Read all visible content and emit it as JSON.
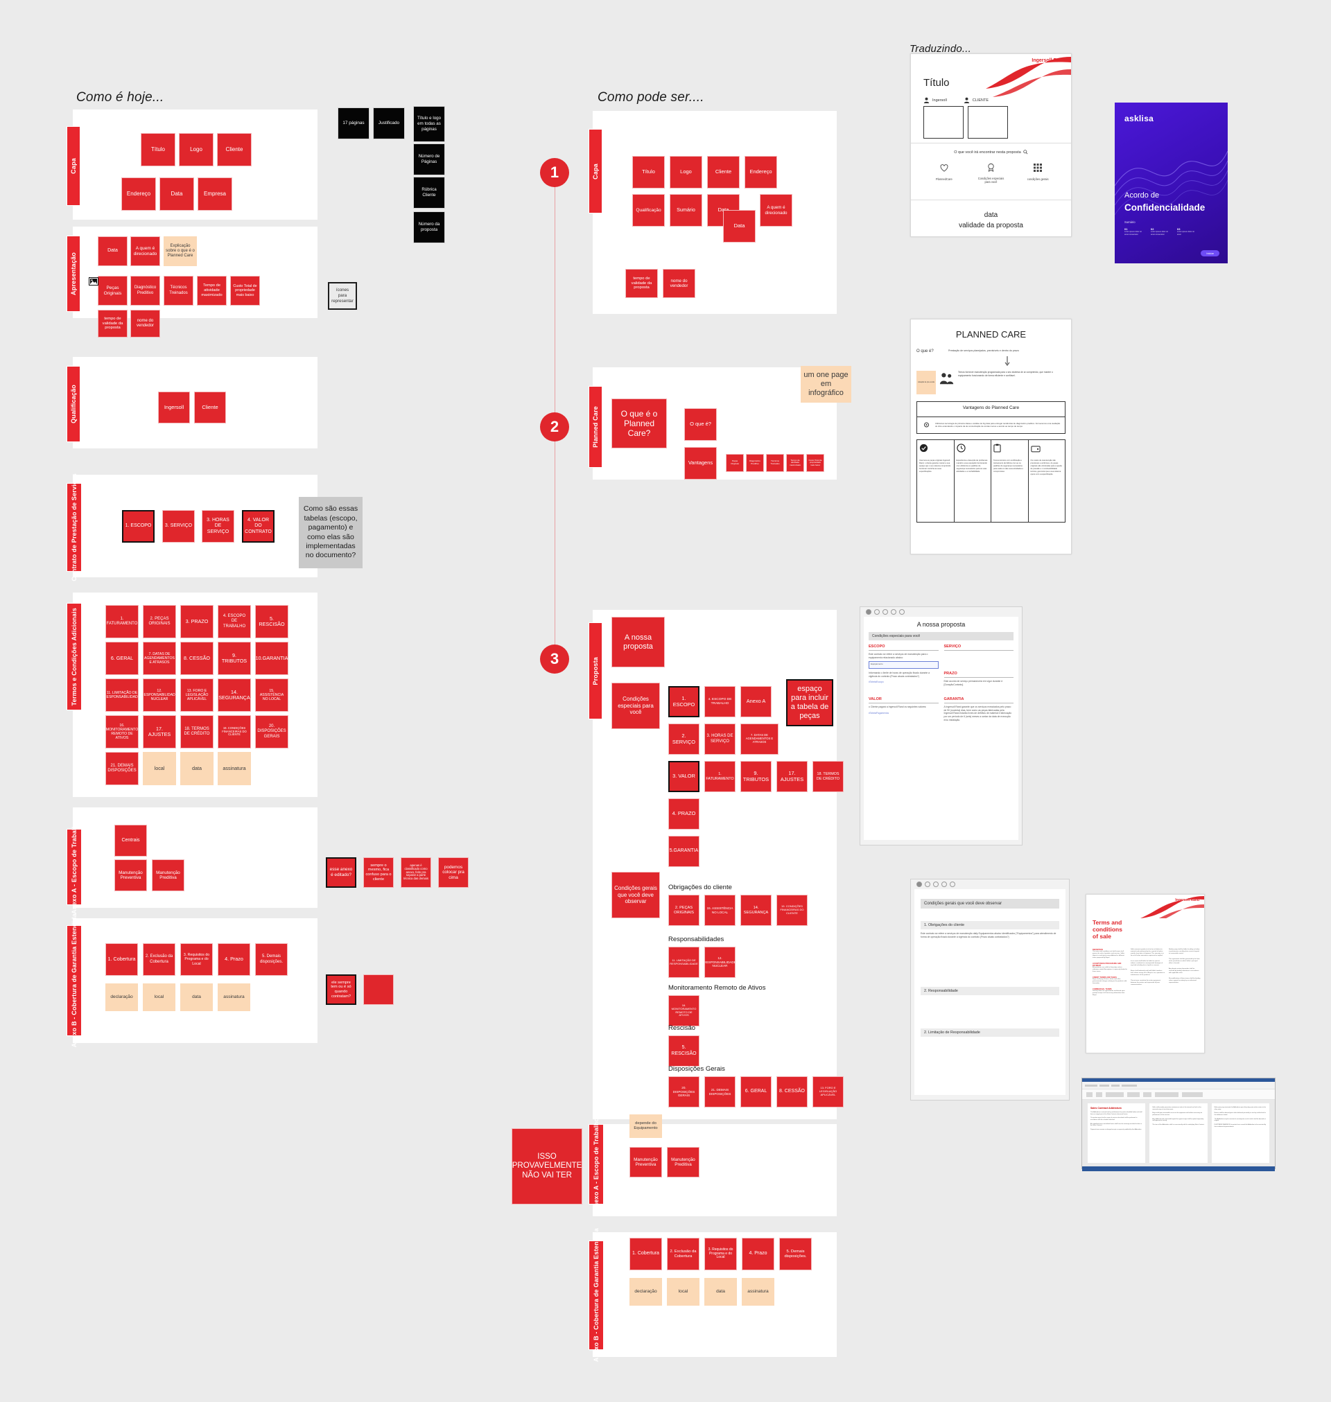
{
  "board": {
    "background": "#ebebeb",
    "accent_red": "#e0262c",
    "accent_peach": "#fbd9b6"
  },
  "headers": {
    "left": "Como é hoje...",
    "right": "Como pode ser....",
    "translating": "Traduzindo..."
  },
  "steps": [
    "1",
    "2",
    "3"
  ],
  "left_sections": [
    {
      "tab": "Capa",
      "rows": [
        [
          "Título",
          "Logo",
          "Cliente"
        ],
        [
          "Endereço",
          "Data",
          "Empresa"
        ]
      ]
    },
    {
      "tab": "Apresentação",
      "rows": [
        [
          "Data",
          "A quem é direcionado"
        ],
        [
          "Peças Originais",
          "Diagnóstico Preditivo",
          "Técnicos Treinados",
          "Tempo de atividade maximizado"
        ],
        [
          "tempo de validade da proposta",
          "nome do vendedor"
        ]
      ],
      "peach": [
        "Explicação sobre o que é o Planned Care",
        "Custo Total de propriedade mais baixo"
      ]
    },
    {
      "tab": "Qualificação",
      "rows": [
        [
          "Ingersoll",
          "Cliente"
        ]
      ]
    },
    {
      "tab": "Contrato de Prestação de Serviços",
      "rows": [
        [
          "1. ESCOPO",
          "3. SERVIÇO",
          "3. HORAS DE SERVIÇO",
          "4. VALOR DO CONTRATO"
        ]
      ]
    },
    {
      "tab": "Termos e Condições Adicionais",
      "grid": [
        [
          "1. FATURAMENTO",
          "2. PEÇAS ORIGINAIS",
          "3. PRAZO",
          "4. ESCOPO DE TRABALHO",
          "5. RESCISÃO"
        ],
        [
          "6. GERAL",
          "7. DATAS DE AGENDAMENTOS E ATRASOS",
          "8. CESSÃO",
          "9. TRIBUTOS",
          "10.GARANTIA"
        ],
        [
          "11. LIMITAÇÃO DE RESPONSABILIDADE",
          "12. RESPONSABILIDADE NUCLEAR",
          "13. FORO E LEGISLAÇÃO APLICÁVEL",
          "14. SEGURANÇA",
          "15. ASSISTÊNCIA NO LOCAL"
        ],
        [
          "16. MONITORAMENTO REMOTO DE ATIVOS",
          "17. AJUSTES",
          "18. TERMOS DE CRÉDITO",
          "19. CONDIÇÕES FINANCEIRAS DO CLIENTE",
          "20. DISPOSIÇÕES GERAIS"
        ],
        [
          "21. DEMAIS DISPOSIÇÕES"
        ]
      ],
      "peach_row": [
        "local",
        "data",
        "assinatura"
      ]
    },
    {
      "tab": "Anexo A - Escopo de Trabalho",
      "rows": [
        [
          "Centrais"
        ],
        [
          "Manutenção Preventiva",
          "Manutenção Preditiva"
        ]
      ]
    },
    {
      "tab": "Anexo B - Cobertura de Garantia Estendida",
      "rows": [
        [
          "1. Cobertura",
          "2. Exclusão da Cobertura",
          "3. Requisitos do Programa e do Local",
          "4. Prazo",
          "5. Demais disposições."
        ]
      ],
      "peach_row": [
        "declaração",
        "local",
        "data",
        "assinatura"
      ]
    }
  ],
  "left_black_notes": [
    "17 páginas",
    "Justificado",
    "Título e logo em todas as páginas",
    "Número de Páginas",
    "Rúbrica Cliente",
    "Número da proposta"
  ],
  "left_outline_notes": [
    "ícones para representar"
  ],
  "left_gray_note": "Como são essas tabelas (escopo, pagamento) e como elas são implementadas no documento?",
  "left_anexoA_notes": [
    "esse anexo é editado?",
    "sempre o mesmo, fica confuso para o cliente",
    "apenas é classificado como anexo, feito pra separar a parte técnica das demais",
    "podemos colocar pra cima"
  ],
  "left_anexoB_note": "ele sempre tem ou é só quando contratam?",
  "right_sections": [
    {
      "tab": "Capa",
      "rows": [
        [
          "Título",
          "Logo",
          "Cliente",
          "Endereço"
        ],
        [
          "Qualificação",
          "Sumário",
          "Data",
          "A quem é direcionado"
        ],
        [
          "Data"
        ],
        [
          "tempo de validade da proposta",
          "nome do vendedor"
        ]
      ]
    },
    {
      "tab": "Planned Care",
      "big": "O que é o Planned Care?",
      "mid": [
        "O que é?",
        "Vantagens"
      ],
      "small": [
        "Peças Originais",
        "Diagnóstico Preditivo",
        "Técnicos Treinados",
        "Tempo de atividade maximizado",
        "Custo Total de propriedade mais baixo"
      ],
      "peach": "um one page em infográfico"
    },
    {
      "tab": "Proposta",
      "title_card": "A nossa proposta",
      "left_cards": [
        "Condições especiais para você",
        "Condições gerais que você deve observar"
      ],
      "peca_note": "espaço para incluir a tabela de peças",
      "scope_rows": [
        [
          "1. ESCOPO",
          "4. ESCOPO DE TRABALHO",
          "Anexo A"
        ],
        [
          "2. SERVIÇO",
          "3. HORAS DE SERVIÇO",
          "7. DATAS DE AGENDAMENTOS E ATRASOS"
        ],
        [
          "3. VALOR",
          "1. FATURAMENTO",
          "9. TRIBUTOS",
          "17. AJUSTES",
          "18. TERMOS DE CRÉDITO"
        ],
        [
          "4. PRAZO"
        ],
        [
          "5.GARANTIA"
        ]
      ],
      "group_titles": [
        "Obrigações do cliente",
        "Responsabilidades",
        "Monitoramento Remoto de Ativos",
        "Rescisão",
        "Disposições Gerais"
      ],
      "group_rows": [
        [
          "2. PEÇAS ORIGINAIS",
          "15. ASSISTÊNCIA NO LOCAL",
          "14. SEGURANÇA",
          "19. CONDIÇÕES FINANCEIRAS DO CLIENTE"
        ],
        [
          "11. LIMITAÇÃO DE RESPONSABILIDADE",
          "12. RESPONSABILIDADE NUCLEAR"
        ],
        [
          "16. MONITORAMENTO REMOTO DE ATIVOS"
        ],
        [
          "5. RESCISÃO"
        ],
        [
          "20. DISPOSIÇÕES GERAIS",
          "21. DEMAIS DISPOSIÇÕES",
          "6. GERAL",
          "8. CESSÃO",
          "13. FORO E LEGISLAÇÃO APLICÁVEL"
        ]
      ]
    },
    {
      "tab": "Anexo A - Escopo de Trabalho",
      "rows": [
        [
          "Manutenção Preventiva",
          "Manutenção Preditiva"
        ]
      ],
      "peach": "depende do Equipamento",
      "side_note": "ISSO PROVAVELMENTE NÃO VAI TER"
    },
    {
      "tab": "Anexo B - Cobertura de Garantia Estendida",
      "rows": [
        [
          "1. Cobertura",
          "2. Exclusão da Cobertura",
          "3. Requisitos do Programa e do Local",
          "4. Prazo",
          "5. Demais disposições."
        ]
      ],
      "peach_row": [
        "declaração",
        "local",
        "data",
        "assinatura"
      ]
    }
  ],
  "mockups": {
    "cover": {
      "brand": "Ingersoll Rand",
      "title": "Título",
      "party_left": "Ingersoll",
      "party_right": "CLIENTE",
      "subhead": "O que você irá encontrar nesta proposta",
      "icons": [
        "PlannedCare",
        "Condições especiais para você",
        "condições gerais"
      ],
      "footer1": "data",
      "footer2": "validade da proposta"
    },
    "planned_care": {
      "title": "PLANNED CARE",
      "q1": "O que é?",
      "q1_text": "Prestação de serviços planejados, previsíveis e dentro do prazo",
      "body": "Temos fornecer manutenção programada para o seu sistema de ar comprimido, que manter o equipamento funcionando de forma eficiente e confiável.",
      "advantages_title": "Vantagens do Planned Care",
      "advantages_lead": "Utilizamos tecnologia de primeira classe e análise de big data para entregar tendências de diagnóstico preditivo. Fornecemos uma avaliação do clico entendendo o impacto da de concentração de contas menos e acordo ao tempo de tempo.",
      "cards": [
        "Usar tera as peças originais Ingersoll Rand, o cliente garante manter a sua equipe que o seu sistema comprimido funcionar continha as suas especificações.",
        "Experiência e detecção de problemas mantêm a sua operação funcionando com eficiência os padrões de segurança necessários para as suas atividades e a confiabilidade.",
        "Temos técnicos com certificação e treinamento de fábrica com as os padrões de segurança necessários para cada um das suas atividades e compromisso.",
        "Os custos de manutenção são previsíveis e uniformes. As peças originais são otimizadas para a queda de pressão e o combustibilidade técnica, gerenciar que a sua sistema opere com a especificação."
      ]
    },
    "asklisa": {
      "brand": "asklisa",
      "line1": "Acordo de",
      "line2": "Confidencialidade",
      "sublabel": "Sumário"
    },
    "proposal_ui": {
      "title": "A nossa proposta",
      "band": "Condições especiais para você",
      "cols": [
        {
          "h": "ESCOPO",
          "body": "Este contrato se refere a serviços de manutenção para o equipamento relacionado abaixo:"
        },
        {
          "h": "SERVIÇO",
          "body": ""
        },
        {
          "h": "PRAZO",
          "body": "Este acordo de serviço permanecerá em vigor durante #[DuraçãoContrato]."
        },
        {
          "h": "VALOR",
          "body": "o Cliente pagará a Ingersoll Rand os seguintes valores:"
        },
        {
          "h": "GARANTIA",
          "body": "A Ingersoll Rand garante que os serviços executados pelo prazo de 90 (noventa) dias, bem como as peças fabricadas pela Ingersoll Rand estarão livres de defeitos de material e fabricação por um período de 6 (seis) meses a contar da data de execução e/ou instalação."
        }
      ],
      "field_placeholder": "Equipamento",
      "tags": [
        "#TabelaEscopo",
        "#TabelaPagamentos"
      ]
    },
    "general_ui": {
      "band": "Condições gerais que você deve observar",
      "items": [
        "1. Obrigações do cliente",
        "2. Responsabilidade",
        "2. Limitação de Responsabilidade"
      ],
      "item_body": "Este contrato se refere a serviços de manutenção daily Equipamentos abaixo identificados (\"Equipamentos\") para atendimento de forma de operação fixado durante a vigência do contrato (Prazo atuais contratados?)"
    },
    "terms_doc": {
      "title": "Terms and conditions of sale",
      "brand": "Ingersoll Rand"
    },
    "word_doc": {
      "title": "Sales Contract Addendum"
    }
  }
}
